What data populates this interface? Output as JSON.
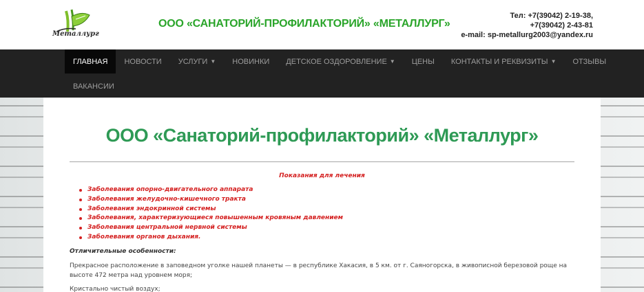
{
  "header": {
    "logo_text": "Металлург",
    "site_title": "ООО «САНАТОРИЙ-ПРОФИЛАКТОРИЙ» «МЕТАЛЛУРГ»",
    "phone_1": "Тел: +7(39042) 2-19-38,",
    "phone_2": "+7(39042) 2-43-81",
    "email": "e-mail: sp-metallurg2003@yandex.ru"
  },
  "nav": {
    "items": [
      {
        "label": "ГЛАВНАЯ",
        "active": true
      },
      {
        "label": "НОВОСТИ"
      },
      {
        "label": "УСЛУГИ"
      },
      {
        "label": "НОВИНКИ"
      },
      {
        "label": "ДЕТСКОЕ ОЗДОРОВЛЕНИЕ"
      },
      {
        "label": "ЦЕНЫ"
      },
      {
        "label": "КОНТАКТЫ И РЕКВИЗИТЫ"
      },
      {
        "label": "ОТЗЫВЫ"
      },
      {
        "label": "ВАКАНСИИ"
      }
    ]
  },
  "main": {
    "title": "ООО «Санаторий-профилакторий» «Металлург»",
    "indications_heading": "Показания для лечения",
    "indications": [
      "Заболевания опорно-двигательного аппарата",
      "Заболевания желудочно-кишечного тракта",
      "Заболевания эндокринной системы",
      "Заболевания, характеризующиеся повышенным кровяным давлением",
      "Заболевания центральной нервной системы",
      "Заболевания органов дыхания."
    ],
    "features_heading": "Отличительные особенности:",
    "paragraph_1": "Прекрасное расположение в заповедном уголке нашей планеты — в республике Хакасия, в 5 км. от г. Саяногорска, в живописной березовой роще на высоте 472 метра над уровнем моря;",
    "paragraph_2": "Кристально чистый воздух;"
  },
  "colors": {
    "brand_green": "#2aa52a",
    "title_green": "#2e9a55",
    "indication_red": "#d42020",
    "navbar_bg": "#222222"
  }
}
